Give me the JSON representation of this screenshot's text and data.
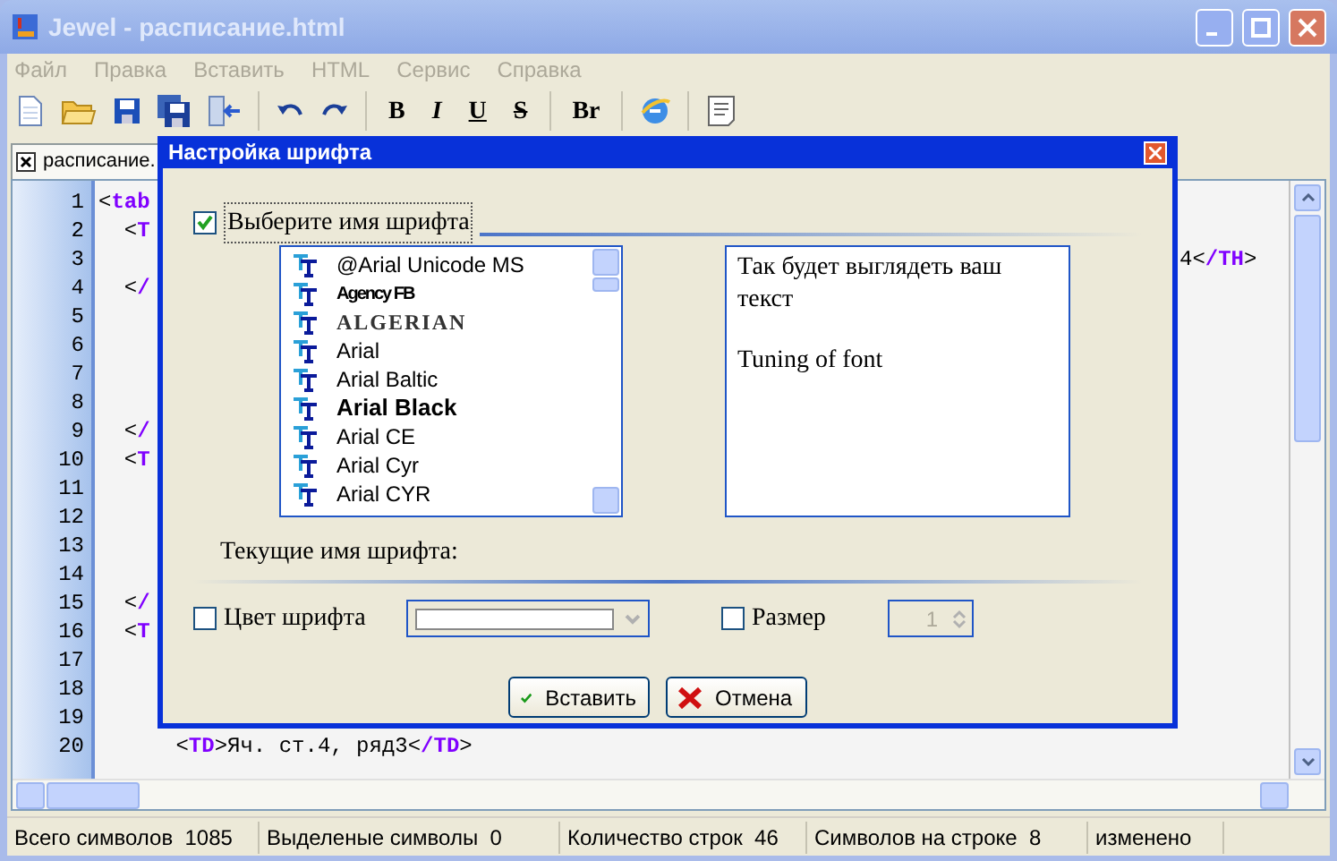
{
  "window": {
    "title": "Jewel - расписание.html"
  },
  "menu": [
    "Файл",
    "Правка",
    "Вставить",
    "HTML",
    "Сервис",
    "Справка"
  ],
  "toolbar": [
    {
      "kind": "new"
    },
    {
      "kind": "open"
    },
    {
      "kind": "save"
    },
    {
      "kind": "saveall"
    },
    {
      "kind": "exit"
    },
    {
      "kind": "separator"
    },
    {
      "kind": "undo"
    },
    {
      "kind": "redo"
    },
    {
      "kind": "separator"
    },
    {
      "kind": "bold",
      "text": "B"
    },
    {
      "kind": "italic",
      "text": "I"
    },
    {
      "kind": "underline",
      "text": "U"
    },
    {
      "kind": "strike",
      "text": "S"
    },
    {
      "kind": "separator"
    },
    {
      "kind": "bold",
      "text": "Br"
    },
    {
      "kind": "separator"
    },
    {
      "kind": "browser"
    },
    {
      "kind": "separator"
    },
    {
      "kind": "notes"
    }
  ],
  "tab": {
    "label": "расписание."
  },
  "editor": {
    "lines": [
      {
        "number": "1",
        "left": [
          {
            "text": "<",
            "kind": "plain"
          },
          {
            "text": "tab",
            "kind": "tag"
          }
        ]
      },
      {
        "number": "2",
        "left": [
          {
            "text": "  <",
            "kind": "plain"
          },
          {
            "text": "T",
            "kind": "tag"
          }
        ]
      },
      {
        "number": "3",
        "right": [
          {
            "text": "4<",
            "kind": "plain"
          },
          {
            "text": "/TH",
            "kind": "tag"
          },
          {
            "text": ">",
            "kind": "plain"
          }
        ]
      },
      {
        "number": "4",
        "left": [
          {
            "text": "  <",
            "kind": "plain"
          },
          {
            "text": "/",
            "kind": "tag"
          }
        ]
      },
      {
        "number": "5"
      },
      {
        "number": "6"
      },
      {
        "number": "7"
      },
      {
        "number": "8"
      },
      {
        "number": "9",
        "left": [
          {
            "text": "  <",
            "kind": "plain"
          },
          {
            "text": "/",
            "kind": "tag"
          }
        ]
      },
      {
        "number": "10",
        "left": [
          {
            "text": "  <",
            "kind": "plain"
          },
          {
            "text": "T",
            "kind": "tag"
          }
        ]
      },
      {
        "number": "11"
      },
      {
        "number": "12"
      },
      {
        "number": "13"
      },
      {
        "number": "14"
      },
      {
        "number": "15",
        "left": [
          {
            "text": "  <",
            "kind": "plain"
          },
          {
            "text": "/",
            "kind": "tag"
          }
        ]
      },
      {
        "number": "16",
        "left": [
          {
            "text": "  <",
            "kind": "plain"
          },
          {
            "text": "T",
            "kind": "tag"
          }
        ]
      },
      {
        "number": "17"
      },
      {
        "number": "18"
      },
      {
        "number": "19"
      },
      {
        "number": "20",
        "left": [
          {
            "text": "      <",
            "kind": "plain"
          },
          {
            "text": "TD",
            "kind": "tag"
          },
          {
            "text": ">Яч. ст.4, ряд3<",
            "kind": "plain"
          },
          {
            "text": "/TD",
            "kind": "tag"
          },
          {
            "text": ">",
            "kind": "plain"
          }
        ]
      }
    ]
  },
  "dialog": {
    "title": "Настройка шрифта",
    "font_name": {
      "label": "Выберите имя шрифта",
      "checked": true
    },
    "fonts": [
      {
        "name": "@Arial Unicode MS",
        "kind": "normal"
      },
      {
        "name": "Agency FB",
        "kind": "condensed"
      },
      {
        "name": "ALGERIAN",
        "kind": "decorative"
      },
      {
        "name": "Arial",
        "kind": "normal"
      },
      {
        "name": "Arial Baltic",
        "kind": "normal"
      },
      {
        "name": "Arial Black",
        "kind": "heavy"
      },
      {
        "name": "Arial CE",
        "kind": "normal"
      },
      {
        "name": "Arial Cyr",
        "kind": "normal"
      },
      {
        "name": "Arial CYR",
        "kind": "normal"
      }
    ],
    "preview": [
      "Так будет выглядеть ваш текст",
      "Tuning of font"
    ],
    "current_label": "Текущие имя шрифта:",
    "color": {
      "label": "Цвет шрифта",
      "checked": false
    },
    "size": {
      "label": "Размер",
      "checked": false,
      "value": "1",
      "disabled": true
    },
    "buttons": [
      {
        "label": "Вставить",
        "kind": "ok"
      },
      {
        "label": "Отмена",
        "kind": "cancel"
      }
    ]
  },
  "status_bar": [
    "Всего символов  1085",
    "Выделеные символы  0",
    "Количество строк  46",
    "Символов на строке  8",
    "изменено"
  ]
}
